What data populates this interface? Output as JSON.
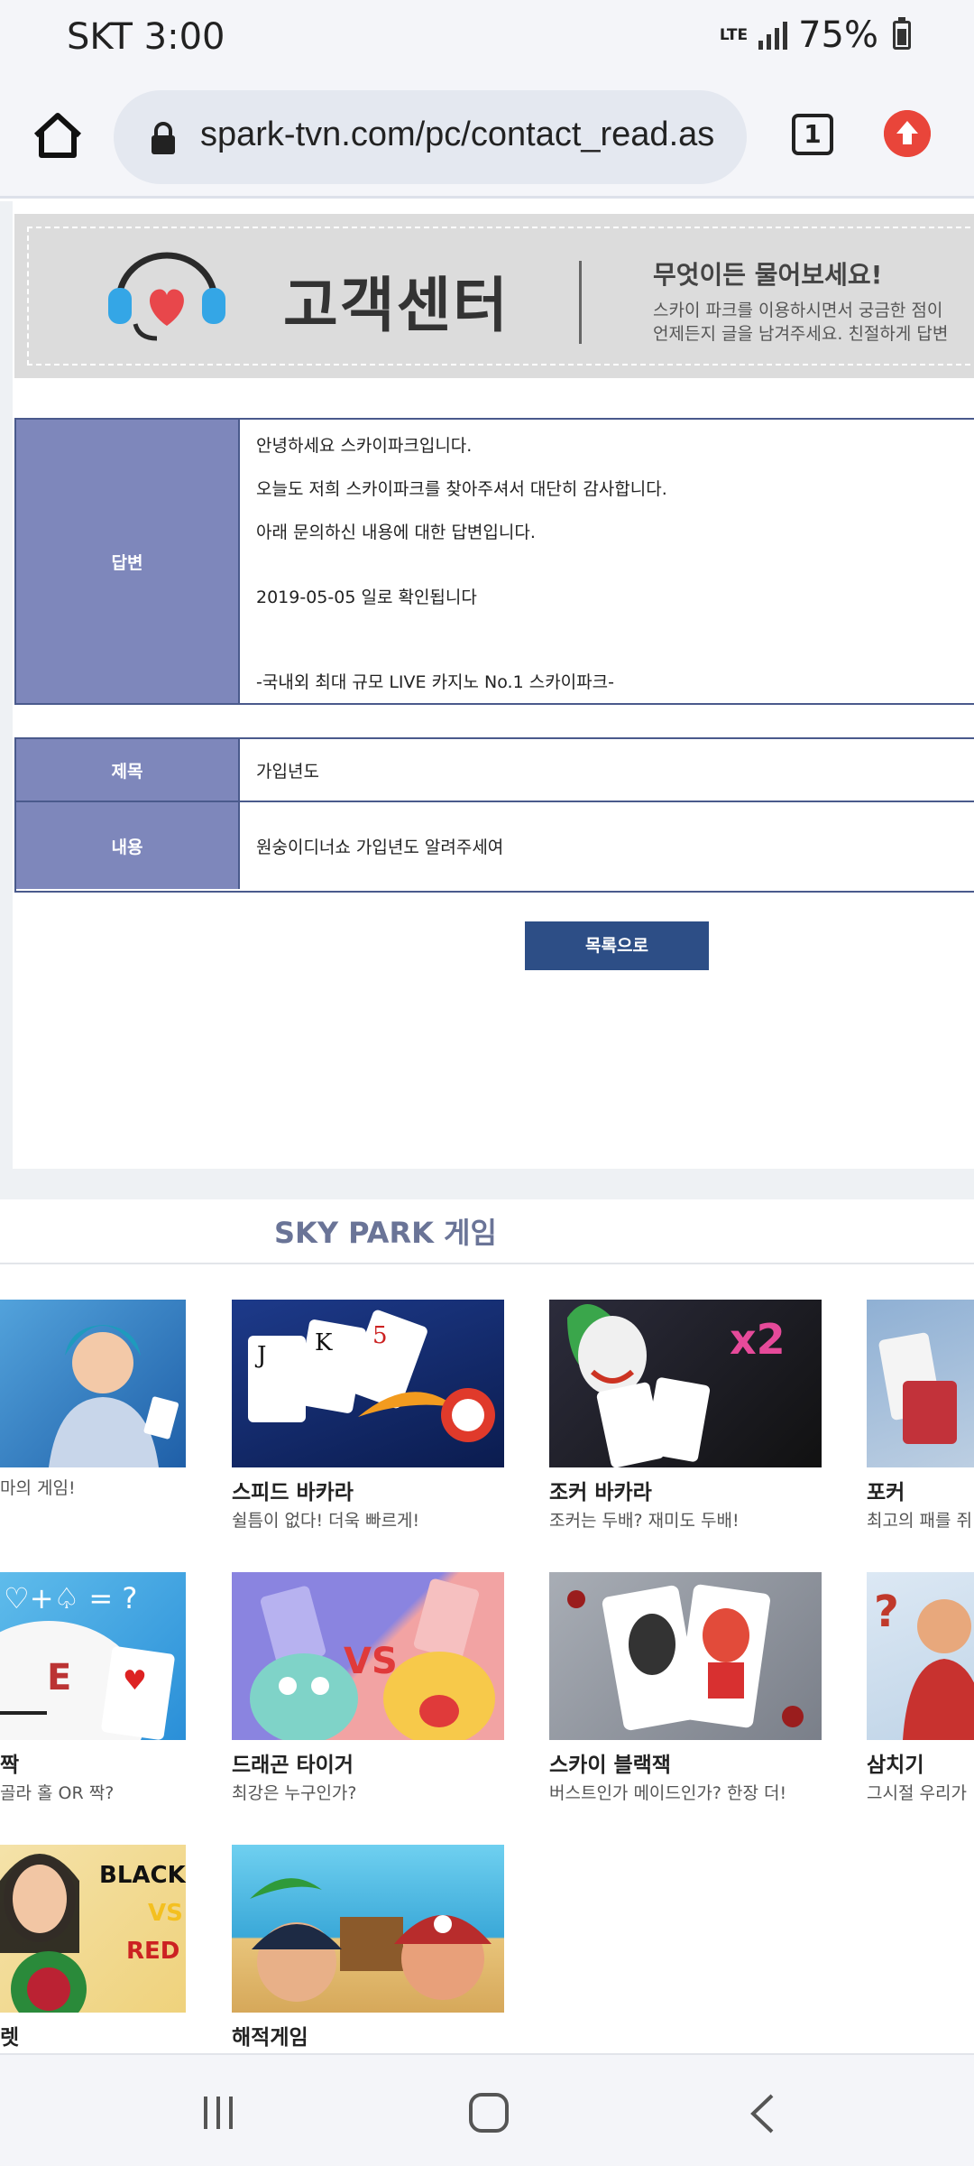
{
  "status_bar": {
    "time": "SKT 3:00",
    "network": "LTE",
    "battery": "75%"
  },
  "browser": {
    "url": "spark-tvn.com/pc/contact_read.as",
    "tab_count": "1"
  },
  "banner": {
    "title": "고객센터",
    "headline": "무엇이든 물어보세요!",
    "sub1": "스카이 파크를 이용하시면서 궁금한 점이",
    "sub2": "언제든지 글을 남겨주세요. 친절하게 답변"
  },
  "answer": {
    "label": "답변",
    "lines": [
      "안녕하세요 스카이파크입니다.",
      "오늘도 저희 스카이파크를 찾아주셔서 대단히 감사합니다.",
      "아래 문의하신 내용에 대한 답변입니다.",
      "2019-05-05 일로 확인됩니다",
      "-국내외 최대 규모 LIVE 카지노 No.1 스카이파크-"
    ]
  },
  "inquiry": {
    "subject_label": "제목",
    "subject": "가입년도",
    "content_label": "내용",
    "content": "원숭이디너쇼 가입년도 알려주세여"
  },
  "list_button": "목록으로",
  "games": {
    "title": "SKY PARK 게임",
    "items": [
      {
        "name": "",
        "desc": "마의 게임!",
        "theme": "casino-lady"
      },
      {
        "name": "스피드 바카라",
        "desc": "쉴틈이 없다! 더욱 빠르게!",
        "theme": "speed-cards"
      },
      {
        "name": "조커 바카라",
        "desc": "조커는 두배? 재미도 두배!",
        "theme": "joker"
      },
      {
        "name": "포커",
        "desc": "최고의 패를 쥐",
        "theme": "poker"
      },
      {
        "name": "짝",
        "desc": "골라 홀 OR 짝?",
        "theme": "odd-even"
      },
      {
        "name": "드래곤 타이거",
        "desc": "최강은 누구인가?",
        "theme": "dragon-tiger"
      },
      {
        "name": "스카이 블랙잭",
        "desc": "버스트인가 메이드인가? 한장 더!",
        "theme": "blackjack"
      },
      {
        "name": "삼치기",
        "desc": "그시절 우리가",
        "theme": "samchigi"
      },
      {
        "name": "렛",
        "desc": "",
        "theme": "roulette",
        "thumb_text": [
          "BLACK",
          "VS",
          "RED"
        ]
      },
      {
        "name": "해적게임",
        "desc": "",
        "theme": "pirates"
      }
    ]
  }
}
